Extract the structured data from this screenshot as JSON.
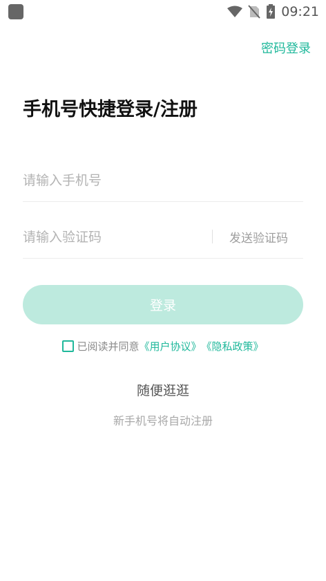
{
  "status_bar": {
    "time": "09:21",
    "icons": [
      "app-icon",
      "wifi-icon",
      "no-sim-icon",
      "battery-charging-icon"
    ]
  },
  "header": {
    "password_login": "密码登录"
  },
  "title": "手机号快捷登录/注册",
  "form": {
    "phone_placeholder": "请输入手机号",
    "phone_value": "",
    "code_placeholder": "请输入验证码",
    "code_value": "",
    "send_code": "发送验证码",
    "login_button": "登录"
  },
  "agreement": {
    "checked": false,
    "prefix": "已阅读并同意",
    "user_agreement": "《用户协议》",
    "privacy_policy": "《隐私政策》"
  },
  "browse": "随便逛逛",
  "note": "新手机号将自动注册",
  "colors": {
    "accent": "#1fb89b",
    "button_disabled": "#bdeade",
    "placeholder": "#b3b3b3"
  }
}
